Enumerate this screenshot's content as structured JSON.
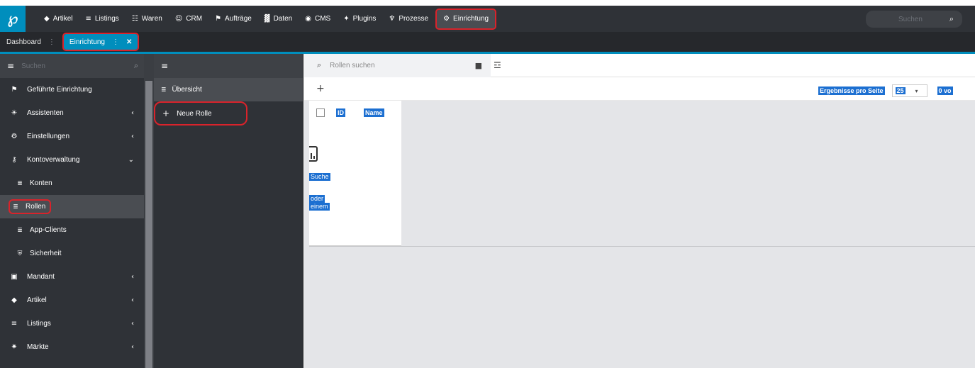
{
  "topbar": {
    "logo": "℘",
    "nav": [
      {
        "icon": "◆",
        "label": "Artikel"
      },
      {
        "icon": "≡",
        "label": "Listings"
      },
      {
        "icon": "☷",
        "label": "Waren"
      },
      {
        "icon": "☺",
        "label": "CRM"
      },
      {
        "icon": "⚑",
        "label": "Aufträge"
      },
      {
        "icon": "▓",
        "label": "Daten"
      },
      {
        "icon": "◉",
        "label": "CMS"
      },
      {
        "icon": "✦",
        "label": "Plugins"
      },
      {
        "icon": "♆",
        "label": "Prozesse"
      },
      {
        "icon": "⚙",
        "label": "Einrichtung"
      }
    ],
    "search_placeholder": "Suchen",
    "search_icon": "⌕"
  },
  "tabs": {
    "dashboard": "Dashboard",
    "dots": "⋮",
    "active": "Einrichtung",
    "active_dots": "⋮",
    "close": "✕"
  },
  "sidebar": {
    "menu_icon": "≡",
    "search_placeholder": "Suchen",
    "search_icon": "⌕",
    "items": [
      {
        "icon": "⚑",
        "label": "Geführte Einrichtung",
        "chevron": ""
      },
      {
        "icon": "☀",
        "label": "Assistenten",
        "chevron": "‹"
      },
      {
        "icon": "⚙",
        "label": "Einstellungen",
        "chevron": "‹"
      },
      {
        "icon": "⚷",
        "label": "Kontoverwaltung",
        "chevron": "⌄"
      },
      {
        "icon": "≣",
        "label": "Konten",
        "chevron": ""
      },
      {
        "icon": "≣",
        "label": "Rollen",
        "chevron": ""
      },
      {
        "icon": "≣",
        "label": "App-Clients",
        "chevron": ""
      },
      {
        "icon": "⛨",
        "label": "Sicherheit",
        "chevron": ""
      },
      {
        "icon": "▣",
        "label": "Mandant",
        "chevron": "‹"
      },
      {
        "icon": "◆",
        "label": "Artikel",
        "chevron": "‹"
      },
      {
        "icon": "≡",
        "label": "Listings",
        "chevron": "‹"
      },
      {
        "icon": "✷",
        "label": "Märkte",
        "chevron": "‹"
      }
    ]
  },
  "middle": {
    "menu_icon": "≡",
    "overview_icon": "≣",
    "overview": "Übersicht",
    "new_icon": "+",
    "new_role": "Neue Rolle"
  },
  "main": {
    "search_icon": "⌕",
    "search_placeholder": "Rollen suchen",
    "bookmark_icon": "■",
    "filter_icon": "☲",
    "add_icon": "+",
    "per_page_label": "Ergebnisse pro Seite",
    "per_page_value": "25",
    "per_page_chevron": "▾",
    "of_text": "0 vo",
    "col_id": "ID",
    "col_name": "Name",
    "empty_text_1": "Suche",
    "empty_text_2": "oder",
    "empty_text_3": "einem"
  }
}
